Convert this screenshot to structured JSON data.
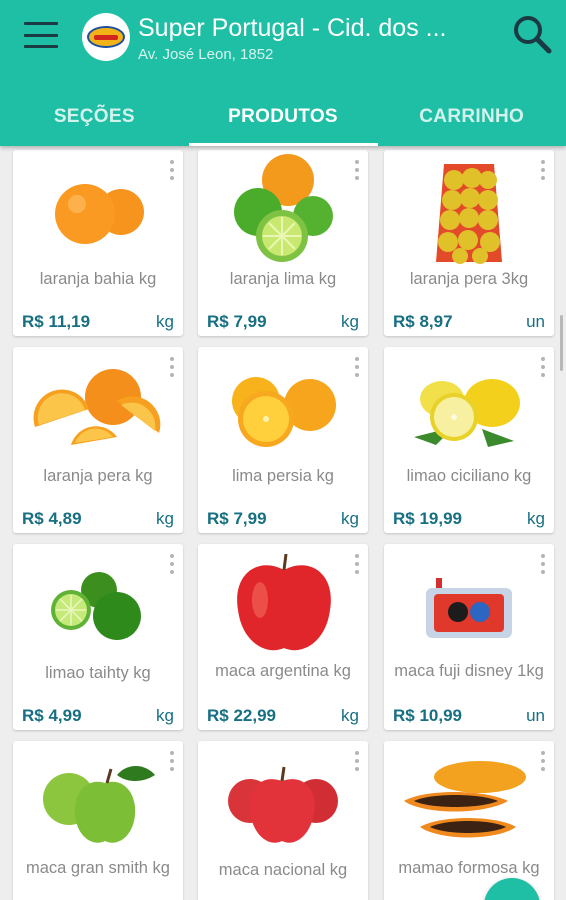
{
  "store": {
    "name": "Super Portugal - Cid. dos ...",
    "address": "Av. José Leon, 1852"
  },
  "tabs": [
    {
      "label": "SEÇÕES",
      "active": false
    },
    {
      "label": "PRODUTOS",
      "active": true
    },
    {
      "label": "CARRINHO",
      "active": false
    }
  ],
  "colors": {
    "primary": "#1fbfa5",
    "price_text": "#176f82",
    "name_text": "#8a8a8a"
  },
  "products": [
    {
      "name": "laranja bahia kg",
      "price": "R$ 11,19",
      "unit": "kg",
      "image": "orange-icon"
    },
    {
      "name": "laranja lima kg",
      "price": "R$ 7,99",
      "unit": "kg",
      "image": "lime-orange-icon"
    },
    {
      "name": "laranja pera 3kg",
      "price": "R$ 8,97",
      "unit": "un",
      "image": "orange-net-bag-icon"
    },
    {
      "name": "laranja pera kg",
      "price": "R$ 4,89",
      "unit": "kg",
      "image": "orange-slices-icon"
    },
    {
      "name": "lima persia kg",
      "price": "R$ 7,99",
      "unit": "kg",
      "image": "lima-icon"
    },
    {
      "name": "limao ciciliano kg",
      "price": "R$ 19,99",
      "unit": "kg",
      "image": "lemon-icon"
    },
    {
      "name": "limao taihty kg",
      "price": "R$ 4,99",
      "unit": "kg",
      "image": "green-lime-icon"
    },
    {
      "name": "maca argentina kg",
      "price": "R$ 22,99",
      "unit": "kg",
      "image": "red-apple-icon"
    },
    {
      "name": "maca fuji disney 1kg",
      "price": "R$ 10,99",
      "unit": "un",
      "image": "apple-package-icon"
    },
    {
      "name": "maca gran smith kg",
      "price": "",
      "unit": "",
      "image": "green-apple-icon"
    },
    {
      "name": "maca nacional kg",
      "price": "",
      "unit": "",
      "image": "red-apples-icon"
    },
    {
      "name": "mamao formosa kg",
      "price": "",
      "unit": "",
      "image": "papaya-icon"
    }
  ]
}
